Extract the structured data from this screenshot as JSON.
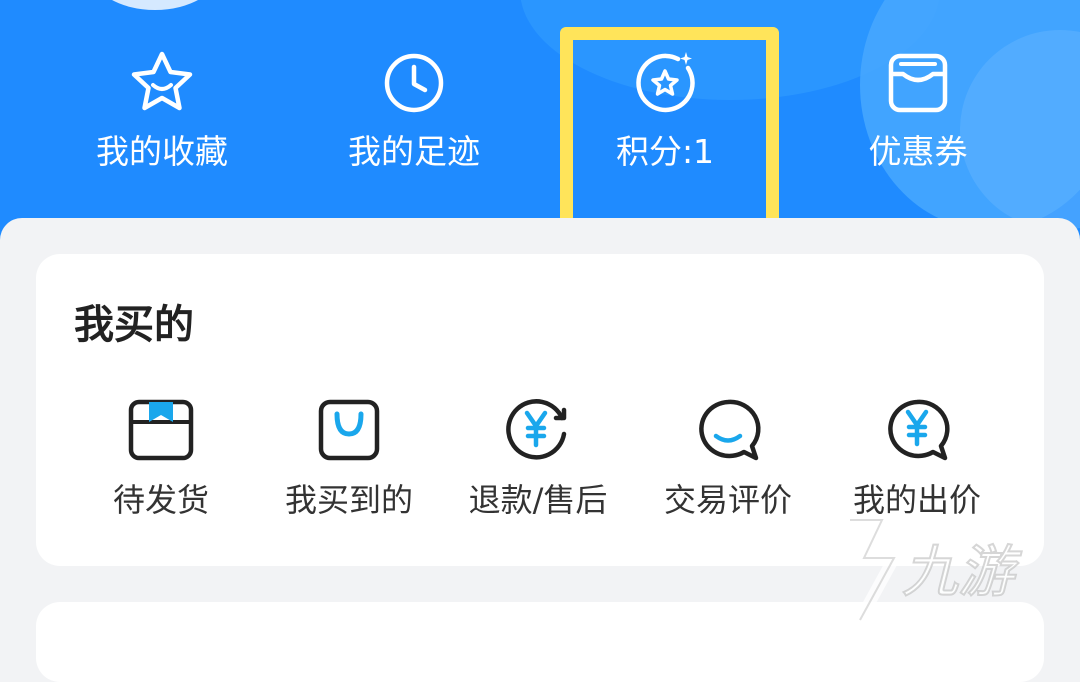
{
  "shortcuts": [
    {
      "label": "我的收藏",
      "icon": "star-face-icon"
    },
    {
      "label": "我的足迹",
      "icon": "clock-icon"
    },
    {
      "label": "积分:1",
      "icon": "points-star-icon"
    },
    {
      "label": "优惠券",
      "icon": "coupon-icon"
    }
  ],
  "buy_section": {
    "title": "我买的",
    "items": [
      {
        "label": "待发货",
        "icon": "package-box-icon"
      },
      {
        "label": "我买到的",
        "icon": "shopping-bag-icon"
      },
      {
        "label": "退款/售后",
        "icon": "refund-yen-icon"
      },
      {
        "label": "交易评价",
        "icon": "chat-smile-icon"
      },
      {
        "label": "我的出价",
        "icon": "bid-yen-bubble-icon"
      }
    ]
  },
  "watermark": {
    "text": "九游"
  },
  "colors": {
    "header_blue": "#1f8bff",
    "highlight_yellow": "#ffe45a",
    "accent_cyan": "#1aa7ec",
    "text_dark": "#333333"
  }
}
